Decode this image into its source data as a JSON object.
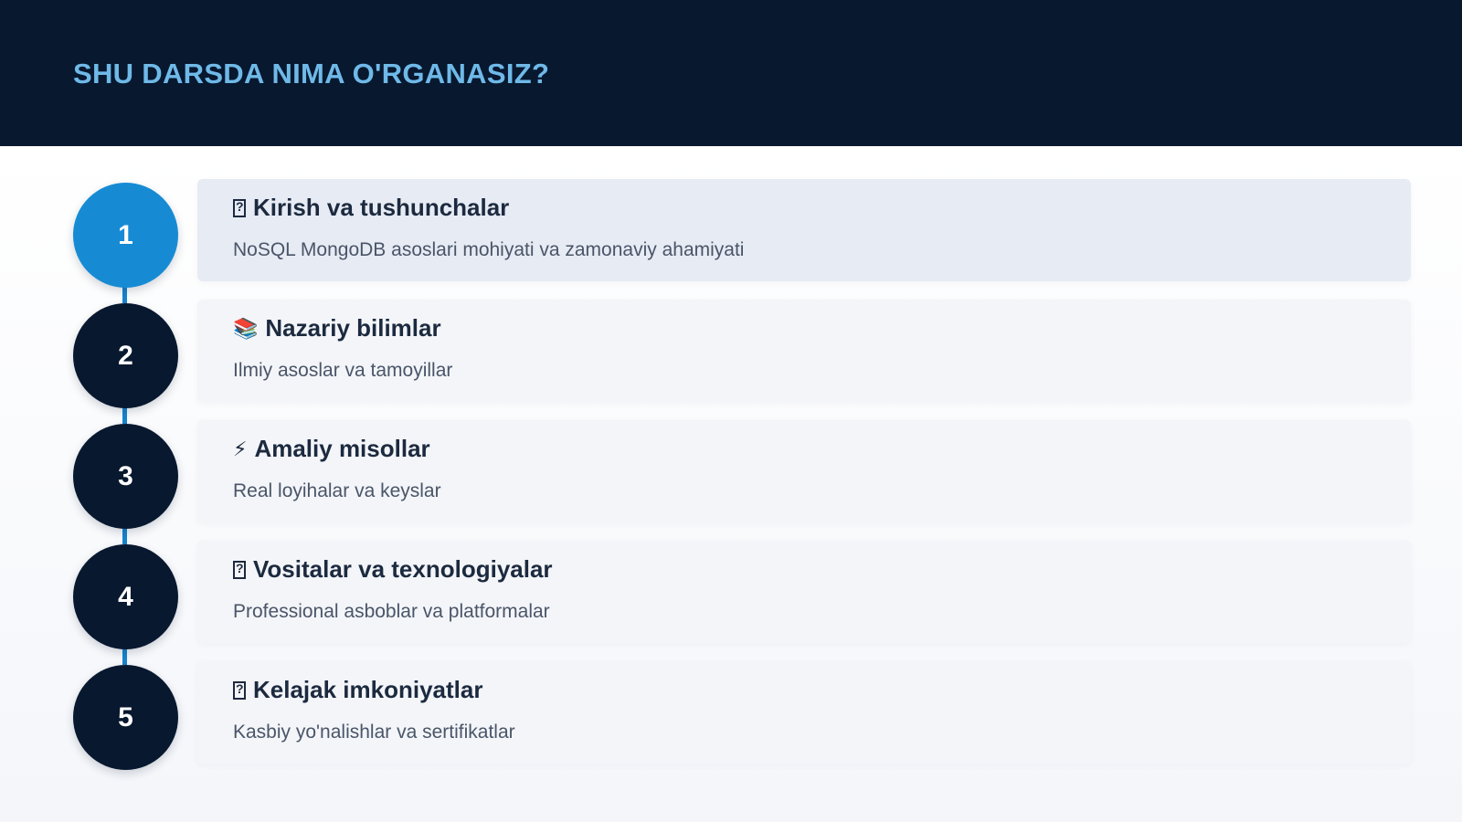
{
  "header": {
    "title": "SHU DARSDA NIMA O'RGANASIZ?"
  },
  "steps": [
    {
      "number": "1",
      "icon": "",
      "icon_name": "missing-glyph-icon",
      "title": "Kirish va tushunchalar",
      "description": "NoSQL MongoDB asoslari mohiyati va zamonaviy ahamiyati",
      "active": true
    },
    {
      "number": "2",
      "icon": "📚",
      "icon_name": "books-icon",
      "title": "Nazariy bilimlar",
      "description": "Ilmiy asoslar va tamoyillar",
      "active": false
    },
    {
      "number": "3",
      "icon": "⚡",
      "icon_name": "lightning-icon",
      "title": "Amaliy misollar",
      "description": "Real loyihalar va keyslar",
      "active": false
    },
    {
      "number": "4",
      "icon": "",
      "icon_name": "missing-glyph-icon",
      "title": "Vositalar va texnologiyalar",
      "description": "Professional asboblar va platformalar",
      "active": false
    },
    {
      "number": "5",
      "icon": "",
      "icon_name": "missing-glyph-icon",
      "title": "Kelajak imkoniyatlar",
      "description": "Kasbiy yo'nalishlar va sertifikatlar",
      "active": false
    }
  ],
  "colors": {
    "header_bg": "#07182f",
    "title_accent": "#6fb9e8",
    "active_circle": "#168bd4",
    "inactive_circle": "#07182f",
    "connector": "#1784cf"
  }
}
